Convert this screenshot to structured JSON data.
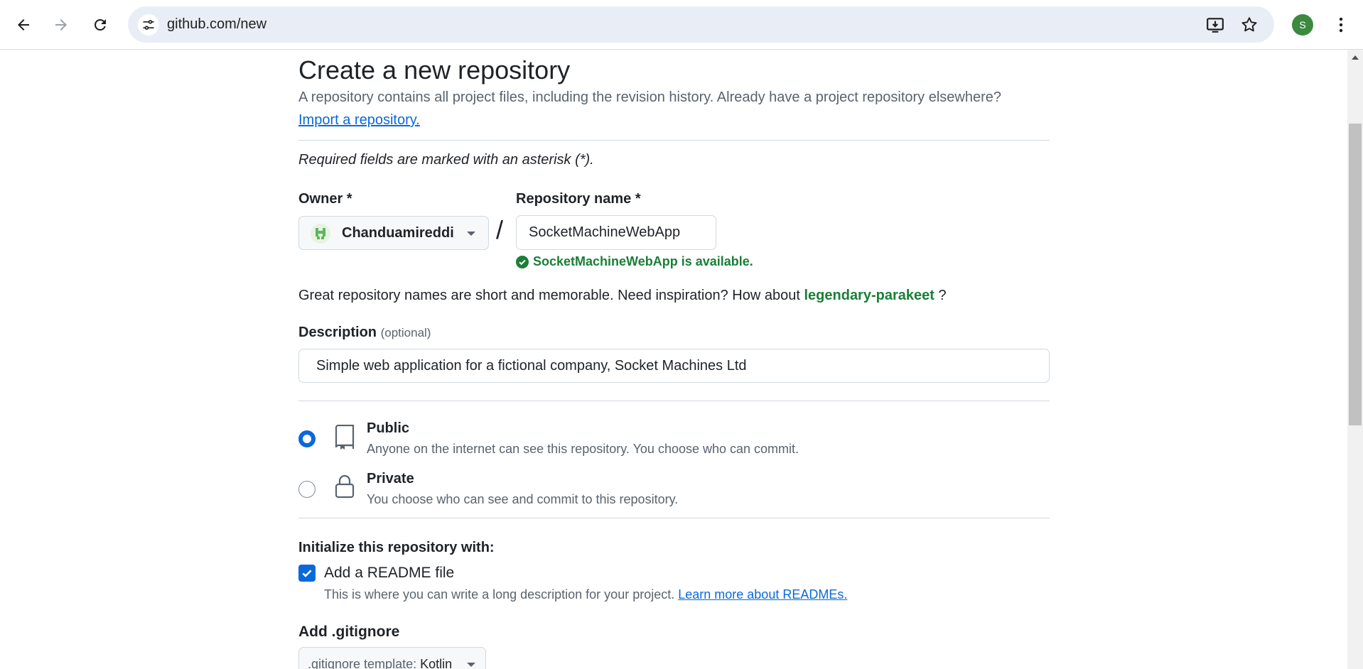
{
  "browser": {
    "url": "github.com/new",
    "profile_initial": "S",
    "icons": [
      "back-arrow-icon",
      "forward-arrow-icon",
      "reload-icon",
      "site-info-icon",
      "install-app-icon",
      "bookmark-star-icon",
      "more-vert-icon"
    ]
  },
  "page": {
    "title": "Create a new repository",
    "intro": "A repository contains all project files, including the revision history. Already have a project repository elsewhere?",
    "import_link": "Import a repository.",
    "required_note": "Required fields are marked with an asterisk (*).",
    "owner_label": "Owner *",
    "owner_value": "Chanduamireddi",
    "separator": "/",
    "repo_label": "Repository name *",
    "repo_value": "SocketMachineWebApp",
    "availability": "SocketMachineWebApp is available.",
    "suggest_prefix": "Great repository names are short and memorable. Need inspiration? How about ",
    "suggest_name": "legendary-parakeet",
    "suggest_suffix": " ?",
    "description_label": "Description",
    "description_optional": "(optional)",
    "description_value": "Simple web application for a fictional company, Socket Machines Ltd",
    "visibility": {
      "selected": "Public",
      "options": [
        {
          "title": "Public",
          "desc": "Anyone on the internet can see this repository. You choose who can commit."
        },
        {
          "title": "Private",
          "desc": "You choose who can see and commit to this repository."
        }
      ]
    },
    "init_title": "Initialize this repository with:",
    "readme_label": "Add a README file",
    "readme_checked": true,
    "readme_desc": "This is where you can write a long description for your project. ",
    "readme_link": "Learn more about READMEs.",
    "gitignore_title": "Add .gitignore",
    "gitignore_prefix": ".gitignore template: ",
    "gitignore_value": "Kotlin"
  },
  "colors": {
    "accent": "#0969da",
    "success": "#1a7f37",
    "muted": "#59636e",
    "border": "#d1d9e0",
    "omnibox_bg": "#e9eef6",
    "avatar_bg": "#3b8a3f"
  }
}
